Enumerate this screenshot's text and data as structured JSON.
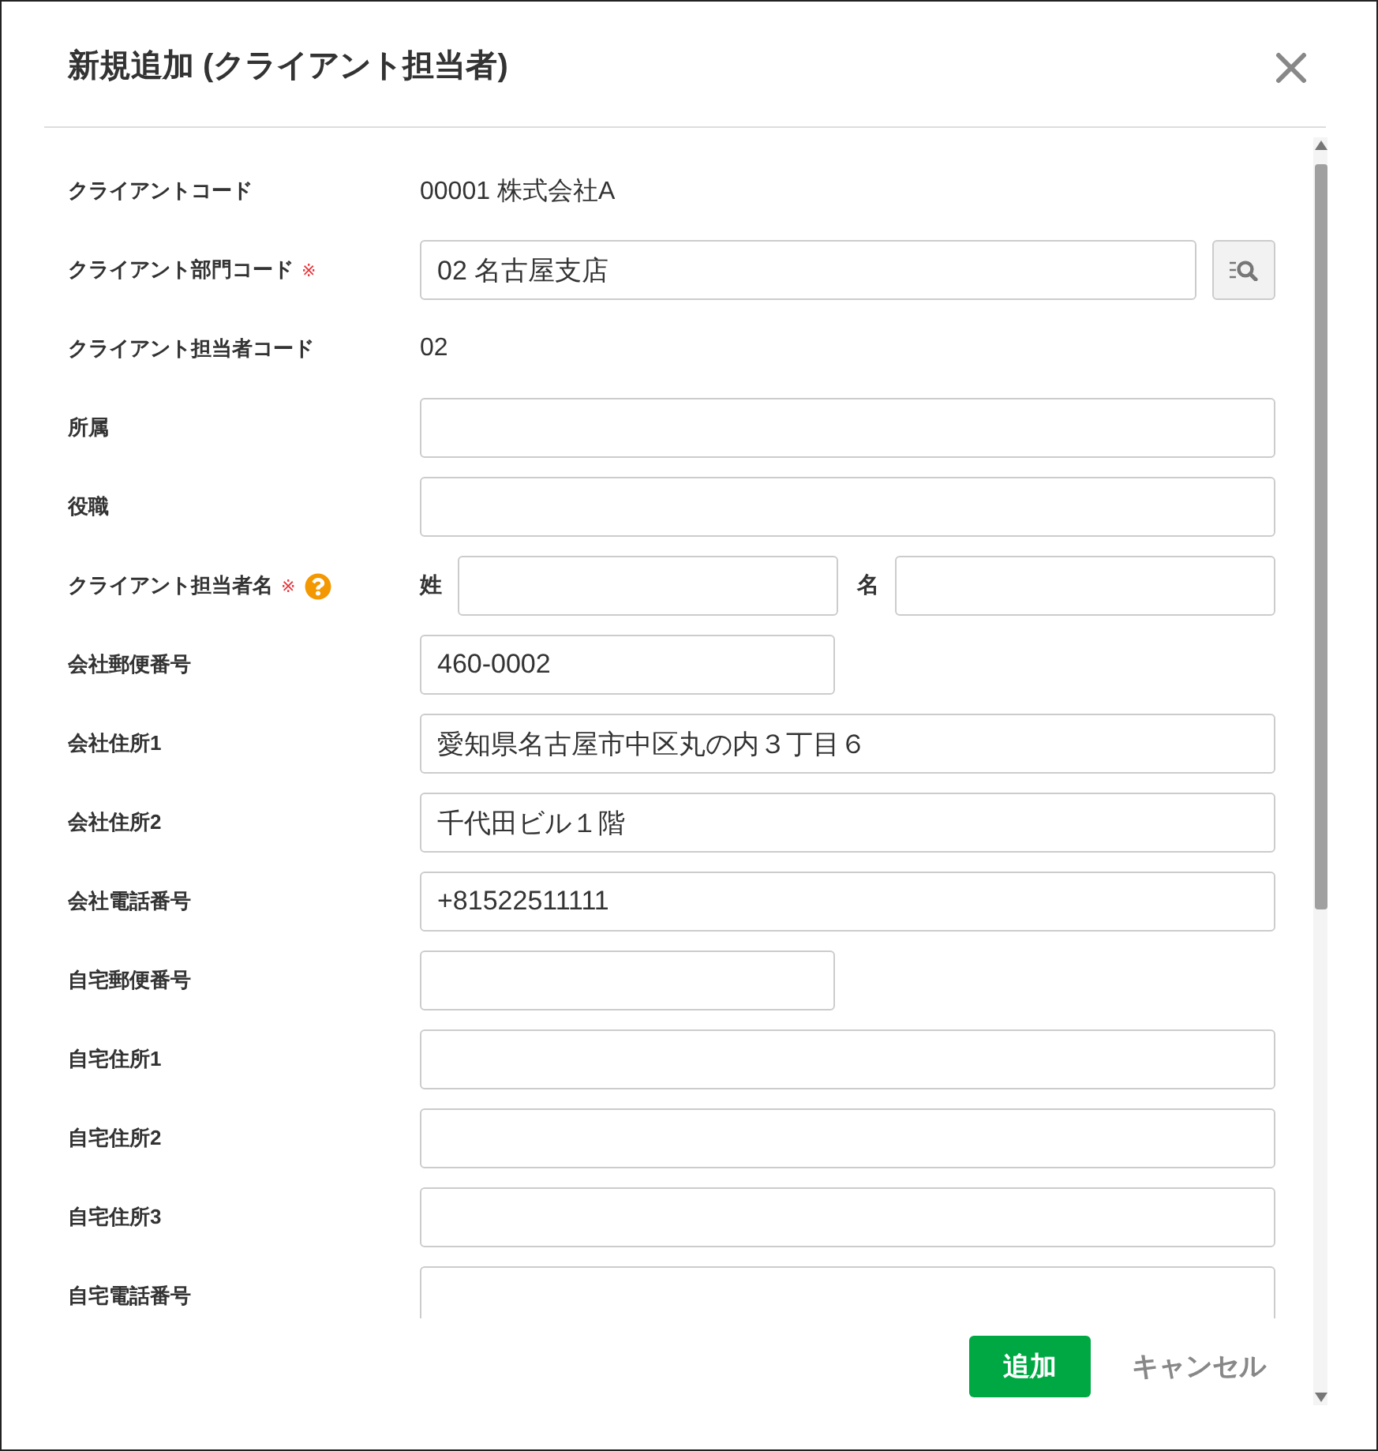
{
  "dialog": {
    "title": "新規追加 (クライアント担当者)"
  },
  "fields": [
    {
      "kind": "static",
      "label": "クライアントコード",
      "value": "00001 株式会社A"
    },
    {
      "kind": "lookup",
      "label": "クライアント部門コード",
      "mark": "※",
      "value": "02 名古屋支店"
    },
    {
      "kind": "static",
      "label": "クライアント担当者コード",
      "value": "02"
    },
    {
      "kind": "input",
      "label": "所属"
    },
    {
      "kind": "input",
      "label": "役職"
    },
    {
      "kind": "name",
      "label": "クライアント担当者名",
      "mark": "※",
      "help": true,
      "parts": [
        {
          "label": "姓"
        },
        {
          "label": "名"
        }
      ]
    },
    {
      "kind": "short",
      "label": "会社郵便番号",
      "value": "460-0002"
    },
    {
      "kind": "input",
      "label": "会社住所1",
      "value": "愛知県名古屋市中区丸の内３丁目６"
    },
    {
      "kind": "input",
      "label": "会社住所2",
      "value": "千代田ビル１階"
    },
    {
      "kind": "input",
      "label": "会社電話番号",
      "value": "+81522511111"
    },
    {
      "kind": "short",
      "label": "自宅郵便番号"
    },
    {
      "kind": "input",
      "label": "自宅住所1"
    },
    {
      "kind": "input",
      "label": "自宅住所2"
    },
    {
      "kind": "input",
      "label": "自宅住所3"
    },
    {
      "kind": "input",
      "label": "自宅電話番号"
    }
  ],
  "buttons": [
    {
      "kind": "primary",
      "label": "追加"
    },
    {
      "kind": "secondary",
      "label": "キャンセル"
    }
  ]
}
